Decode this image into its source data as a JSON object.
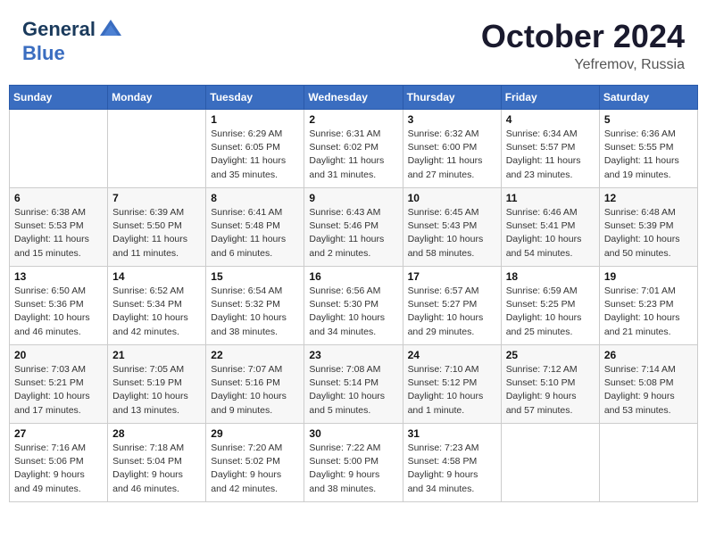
{
  "header": {
    "logo_line1": "General",
    "logo_line2": "Blue",
    "month": "October 2024",
    "location": "Yefremov, Russia"
  },
  "weekdays": [
    "Sunday",
    "Monday",
    "Tuesday",
    "Wednesday",
    "Thursday",
    "Friday",
    "Saturday"
  ],
  "weeks": [
    [
      {
        "day": "",
        "info": ""
      },
      {
        "day": "",
        "info": ""
      },
      {
        "day": "1",
        "info": "Sunrise: 6:29 AM\nSunset: 6:05 PM\nDaylight: 11 hours and 35 minutes."
      },
      {
        "day": "2",
        "info": "Sunrise: 6:31 AM\nSunset: 6:02 PM\nDaylight: 11 hours and 31 minutes."
      },
      {
        "day": "3",
        "info": "Sunrise: 6:32 AM\nSunset: 6:00 PM\nDaylight: 11 hours and 27 minutes."
      },
      {
        "day": "4",
        "info": "Sunrise: 6:34 AM\nSunset: 5:57 PM\nDaylight: 11 hours and 23 minutes."
      },
      {
        "day": "5",
        "info": "Sunrise: 6:36 AM\nSunset: 5:55 PM\nDaylight: 11 hours and 19 minutes."
      }
    ],
    [
      {
        "day": "6",
        "info": "Sunrise: 6:38 AM\nSunset: 5:53 PM\nDaylight: 11 hours and 15 minutes."
      },
      {
        "day": "7",
        "info": "Sunrise: 6:39 AM\nSunset: 5:50 PM\nDaylight: 11 hours and 11 minutes."
      },
      {
        "day": "8",
        "info": "Sunrise: 6:41 AM\nSunset: 5:48 PM\nDaylight: 11 hours and 6 minutes."
      },
      {
        "day": "9",
        "info": "Sunrise: 6:43 AM\nSunset: 5:46 PM\nDaylight: 11 hours and 2 minutes."
      },
      {
        "day": "10",
        "info": "Sunrise: 6:45 AM\nSunset: 5:43 PM\nDaylight: 10 hours and 58 minutes."
      },
      {
        "day": "11",
        "info": "Sunrise: 6:46 AM\nSunset: 5:41 PM\nDaylight: 10 hours and 54 minutes."
      },
      {
        "day": "12",
        "info": "Sunrise: 6:48 AM\nSunset: 5:39 PM\nDaylight: 10 hours and 50 minutes."
      }
    ],
    [
      {
        "day": "13",
        "info": "Sunrise: 6:50 AM\nSunset: 5:36 PM\nDaylight: 10 hours and 46 minutes."
      },
      {
        "day": "14",
        "info": "Sunrise: 6:52 AM\nSunset: 5:34 PM\nDaylight: 10 hours and 42 minutes."
      },
      {
        "day": "15",
        "info": "Sunrise: 6:54 AM\nSunset: 5:32 PM\nDaylight: 10 hours and 38 minutes."
      },
      {
        "day": "16",
        "info": "Sunrise: 6:56 AM\nSunset: 5:30 PM\nDaylight: 10 hours and 34 minutes."
      },
      {
        "day": "17",
        "info": "Sunrise: 6:57 AM\nSunset: 5:27 PM\nDaylight: 10 hours and 29 minutes."
      },
      {
        "day": "18",
        "info": "Sunrise: 6:59 AM\nSunset: 5:25 PM\nDaylight: 10 hours and 25 minutes."
      },
      {
        "day": "19",
        "info": "Sunrise: 7:01 AM\nSunset: 5:23 PM\nDaylight: 10 hours and 21 minutes."
      }
    ],
    [
      {
        "day": "20",
        "info": "Sunrise: 7:03 AM\nSunset: 5:21 PM\nDaylight: 10 hours and 17 minutes."
      },
      {
        "day": "21",
        "info": "Sunrise: 7:05 AM\nSunset: 5:19 PM\nDaylight: 10 hours and 13 minutes."
      },
      {
        "day": "22",
        "info": "Sunrise: 7:07 AM\nSunset: 5:16 PM\nDaylight: 10 hours and 9 minutes."
      },
      {
        "day": "23",
        "info": "Sunrise: 7:08 AM\nSunset: 5:14 PM\nDaylight: 10 hours and 5 minutes."
      },
      {
        "day": "24",
        "info": "Sunrise: 7:10 AM\nSunset: 5:12 PM\nDaylight: 10 hours and 1 minute."
      },
      {
        "day": "25",
        "info": "Sunrise: 7:12 AM\nSunset: 5:10 PM\nDaylight: 9 hours and 57 minutes."
      },
      {
        "day": "26",
        "info": "Sunrise: 7:14 AM\nSunset: 5:08 PM\nDaylight: 9 hours and 53 minutes."
      }
    ],
    [
      {
        "day": "27",
        "info": "Sunrise: 7:16 AM\nSunset: 5:06 PM\nDaylight: 9 hours and 49 minutes."
      },
      {
        "day": "28",
        "info": "Sunrise: 7:18 AM\nSunset: 5:04 PM\nDaylight: 9 hours and 46 minutes."
      },
      {
        "day": "29",
        "info": "Sunrise: 7:20 AM\nSunset: 5:02 PM\nDaylight: 9 hours and 42 minutes."
      },
      {
        "day": "30",
        "info": "Sunrise: 7:22 AM\nSunset: 5:00 PM\nDaylight: 9 hours and 38 minutes."
      },
      {
        "day": "31",
        "info": "Sunrise: 7:23 AM\nSunset: 4:58 PM\nDaylight: 9 hours and 34 minutes."
      },
      {
        "day": "",
        "info": ""
      },
      {
        "day": "",
        "info": ""
      }
    ]
  ]
}
